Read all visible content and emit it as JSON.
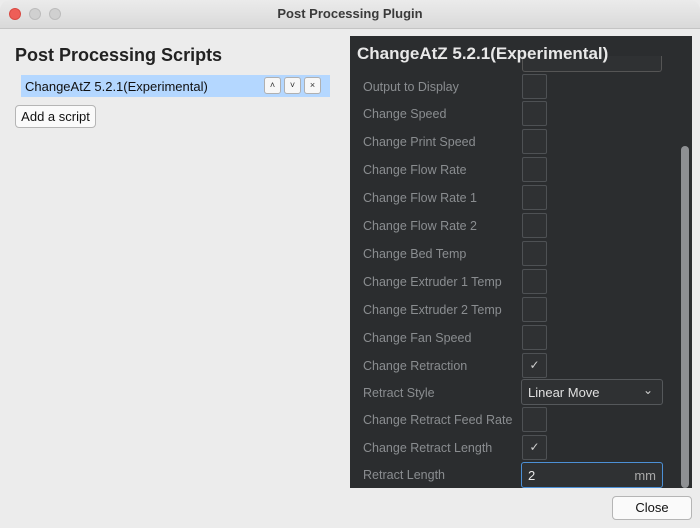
{
  "window": {
    "title": "Post Processing Plugin"
  },
  "left": {
    "heading": "Post Processing Scripts",
    "scripts": [
      {
        "label": "ChangeAtZ 5.2.1(Experimental)"
      }
    ],
    "row_buttons": {
      "up": "˄",
      "down": "˅",
      "remove": "×"
    },
    "add_script": "Add a script"
  },
  "panel": {
    "title": "ChangeAtZ 5.2.1(Experimental)",
    "settings": [
      {
        "label": "Output to Display",
        "checked": false
      },
      {
        "label": "Change Speed",
        "checked": false
      },
      {
        "label": "Change Print Speed",
        "checked": false
      },
      {
        "label": "Change Flow Rate",
        "checked": false
      },
      {
        "label": "Change Flow Rate 1",
        "checked": false
      },
      {
        "label": "Change Flow Rate 2",
        "checked": false
      },
      {
        "label": "Change Bed Temp",
        "checked": false
      },
      {
        "label": "Change Extruder 1 Temp",
        "checked": false
      },
      {
        "label": "Change Extruder 2 Temp",
        "checked": false
      },
      {
        "label": "Change Fan Speed",
        "checked": false
      },
      {
        "label": "Change Retraction",
        "checked": true
      },
      {
        "label": "Retract Style",
        "select": "Linear Move"
      },
      {
        "label": "Change Retract Feed Rate",
        "checked": false
      },
      {
        "label": "Change Retract Length",
        "checked": true
      },
      {
        "label": "Retract Length",
        "value": "2",
        "unit": "mm"
      }
    ],
    "check_mark": "✓",
    "select_chevron": "⌄"
  },
  "footer": {
    "close": "Close"
  }
}
